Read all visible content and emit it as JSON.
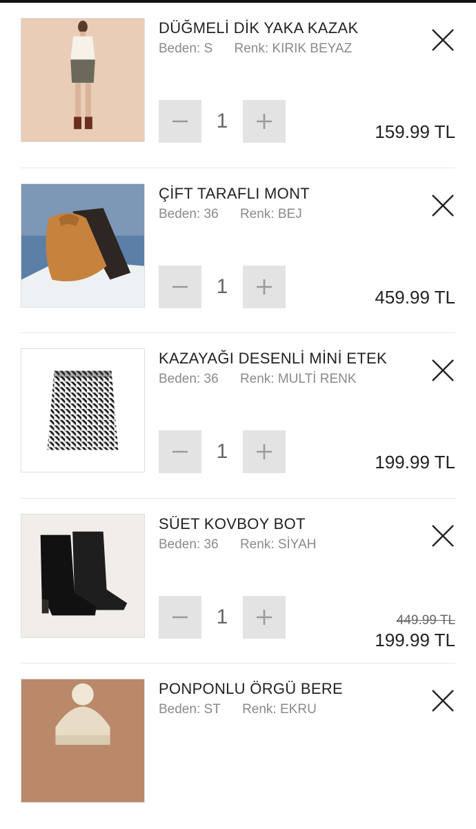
{
  "labels": {
    "size_prefix": "Beden:",
    "color_prefix": "Renk:"
  },
  "items": [
    {
      "name": "DÜĞMELİ DİK YAKA KAZAK",
      "size": "S",
      "color": "KIRIK BEYAZ",
      "quantity": "1",
      "price": "159.99 TL",
      "old_price": null
    },
    {
      "name": "ÇİFT TARAFLI MONT",
      "size": "36",
      "color": "BEJ",
      "quantity": "1",
      "price": "459.99 TL",
      "old_price": null
    },
    {
      "name": "KAZAYAĞI DESENLİ MİNİ ETEK",
      "size": "36",
      "color": "MULTİ RENK",
      "quantity": "1",
      "price": "199.99 TL",
      "old_price": null
    },
    {
      "name": "SÜET KOVBOY BOT",
      "size": "36",
      "color": "SİYAH",
      "quantity": "1",
      "price": "199.99 TL",
      "old_price": "449.99 TL"
    },
    {
      "name": "PONPONLU ÖRGÜ BERE",
      "size": "ST",
      "color": "EKRU",
      "quantity": null,
      "price": null,
      "old_price": null
    }
  ],
  "icons": {
    "remove": "close-icon",
    "decrease": "minus-icon",
    "increase": "plus-icon"
  },
  "colors": {
    "button_bg": "#e3e3e3",
    "text": "#222222",
    "muted": "#8a8a8a"
  }
}
